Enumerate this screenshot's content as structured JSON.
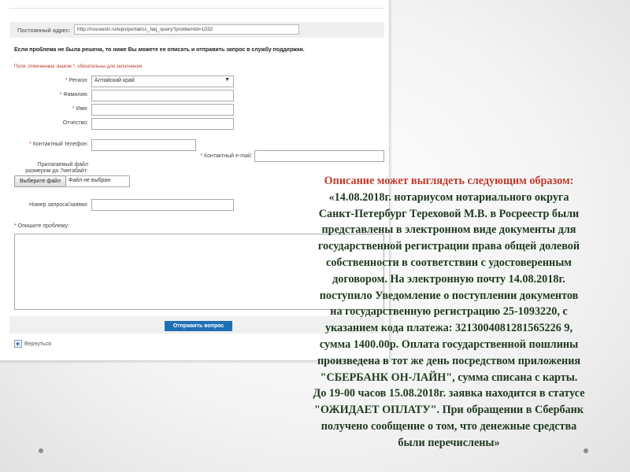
{
  "form": {
    "permalink_label": "Постоянный адрес:",
    "permalink_value": "http://rosreestr.ru/wps/portal/cc_faq_query?problemId=1032",
    "help_text": "Если проблема не была решена, то ниже Вы можете ее описать и отправить запрос в службу поддержки.",
    "required_note": "Поля, отмеченные знаком *, обязательны для заполнения",
    "region_label": "Регион:",
    "region_value": "Алтайский край",
    "surname_label": "Фамилия:",
    "name_label": "Имя:",
    "patronymic_label": "Отчество:",
    "phone_label": "Контактный телефон:",
    "email_label": "Контактный e-mail:",
    "file_label_line1": "Прилагаемый файл",
    "file_label_line2": "размером до 7мегабайт:",
    "file_button": "Выберите файл",
    "file_status": "Файл не выбран",
    "request_number_label": "Номер запроса/заявки:",
    "problem_label": "Опишите проблему:",
    "submit_button": "Отправить вопрос",
    "back_link": "Вернуться"
  },
  "description": {
    "title": "Описание может выглядеть следующим образом:",
    "lines": [
      "«14.08.2018г. нотариусом нотариального округа",
      "Санкт-Петербург Тереховой М.В. в Росреестр были",
      "представлены в электронном виде документы для",
      "государственной регистрации права общей долевой",
      "собственности в соответствии с удостоверенным",
      "договором. На электронную почту 14.08.2018г.",
      "поступило Уведомление о поступлении документов",
      "на государственную регистрацию 25-1093220, с",
      "указанием кода платежа: 3213004081281565226 9,",
      "сумма 1400.00р. Оплата государственной пошлины",
      "произведена в тот же день посредством приложения",
      "\"СБЕРБАНК ОН-ЛАЙН\", сумма списана с карты.",
      "До 19-00 часов 15.08.2018г. заявка находится в статусе",
      "\"ОЖИДАЕТ ОПЛАТУ\". При обращении в Сбербанк",
      "получено сообщение о том, что денежные средства",
      "были перечислены»"
    ]
  },
  "colors": {
    "title_red": "#c0392b",
    "body_green": "#1f3a1f",
    "button_blue": "#1f6fb4"
  }
}
